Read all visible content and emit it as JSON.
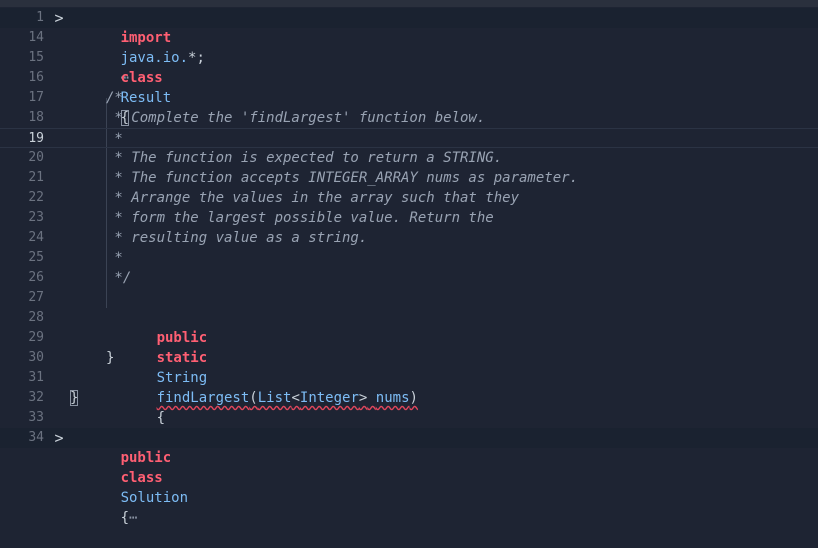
{
  "colors": {
    "background": "#1e2433",
    "keyword": "#ff5f73",
    "type": "#7dbcf5",
    "comment": "#99a3b3",
    "line_number": "#6b7280",
    "error_squiggle": "#e0465c"
  },
  "icons": {
    "fold_closed": "chevron-right-icon",
    "collapsed": "ellipsis-icon"
  },
  "editor": {
    "line_numbers": [
      "1",
      "14",
      "15",
      "16",
      "17",
      "18",
      "19",
      "20",
      "21",
      "22",
      "23",
      "24",
      "25",
      "26",
      "27",
      "28",
      "29",
      "30",
      "31",
      "32",
      "33",
      "34"
    ],
    "fold_glyph": ">",
    "ellipsis": "⋯",
    "lines": {
      "l1": {
        "kw": "import",
        "pkg": "java.io.",
        "star": "*;"
      },
      "l15": {
        "kw": "class",
        "name": "Result",
        "brace": "{"
      },
      "l17": "/*",
      "l18": " * Complete the 'findLargest' function below.",
      "l19": " *",
      "l20": " * The function is expected to return a STRING.",
      "l21": " * The function accepts INTEGER_ARRAY nums as parameter.",
      "l22": " * Arrange the values in the array such that they",
      "l23": " * form the largest possible value. Return the",
      "l24": " * resulting value as a string.",
      "l25": " *",
      "l26": " */",
      "l28": {
        "kw1": "public",
        "kw2": "static",
        "ret": "String",
        "method": "findLargest",
        "open": "(",
        "list": "List",
        "lt": "<",
        "gen": "Integer",
        "gt": ">",
        "param": "nums",
        "close": ")",
        "brace": "{"
      },
      "l30": "}",
      "l32": "}",
      "l34": {
        "kw1": "public",
        "kw2": "class",
        "name": "Solution",
        "brace": "{"
      }
    }
  }
}
